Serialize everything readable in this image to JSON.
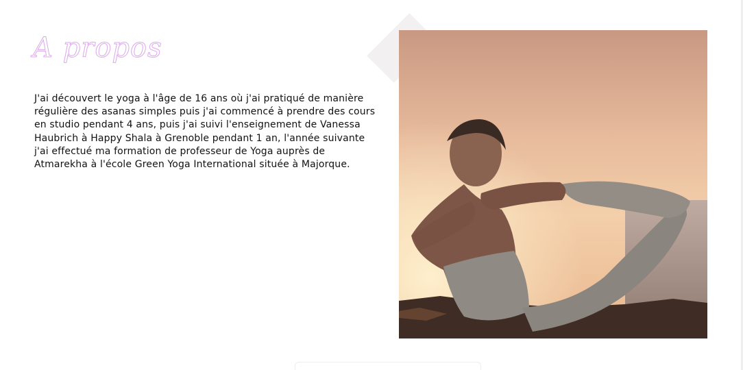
{
  "about": {
    "title": "A propos",
    "text": "J'ai découvert le yoga à l'âge de 16 ans où j'ai pratiqué de manière régulière des asanas simples puis j'ai commencé à prendre des cours en studio pendant 4 ans, puis j'ai suivi l'enseignement de Vanessa Haubrich à Happy Shala à Grenoble pendant 1 an, l'année suivante j'ai effectué ma formation de professeur de Yoga auprès de Atmarekha à l'école Green Yoga International située à Majorque."
  },
  "colors": {
    "title_accent": "#dba8ea",
    "text": "#111111",
    "background": "#ffffff"
  }
}
